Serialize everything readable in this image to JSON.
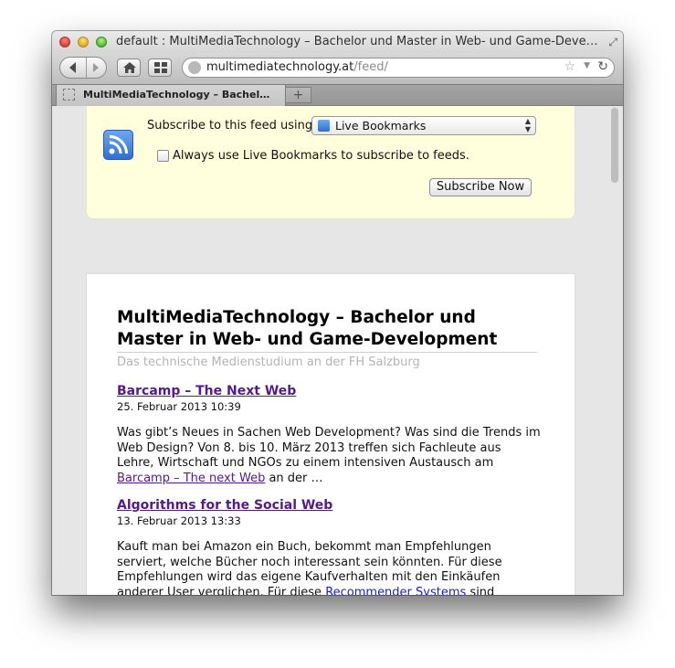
{
  "window": {
    "title": "default : MultiMediaTechnology – Bachelor und Master in Web- und Game-Develo…"
  },
  "toolbar": {
    "url_host": "multimediatechnology.at",
    "url_path": "/feed/"
  },
  "tabs": [
    {
      "label": "MultiMediaTechnology – Bachel…"
    }
  ],
  "subscribe": {
    "label": "Subscribe to this feed using",
    "selected_reader": "Live Bookmarks",
    "always_use_label": "Always use Live Bookmarks to subscribe to feeds.",
    "always_use_checked": false,
    "button_label": "Subscribe Now"
  },
  "feed": {
    "title": "MultiMediaTechnology – Bachelor und Master in Web- und Game-Development",
    "subtitle": "Das technische Medienstudium an der FH Salzburg",
    "entries": [
      {
        "title": "Barcamp – The Next Web",
        "date": "25. Februar 2013 10:39",
        "text_before": "Was gibt’s Neues in Sachen Web Development? Was sind die Trends im Web Design? Von 8. bis 10. März 2013 treffen sich Fachleute aus Lehre, Wirtschaft und NGOs zu einem intensiven Austausch am ",
        "link": "Barcamp – The next Web",
        "text_after": " an der …"
      },
      {
        "title": "Algorithms for the Social Web",
        "date": "13. Februar 2013 13:33",
        "text_before": "Kauft man bei Amazon ein Buch, bekommt man Empfehlungen serviert, welche Bücher noch interessant sein könnten. Für diese Empfehlungen wird das eigene Kaufverhalten mit den Einkäufen anderer User verglichen. Für diese ",
        "link": "Recommender Systems ",
        "text_after": "sind aufwendige Berechnungen auf sehr großen Datenbeständen …"
      }
    ]
  },
  "colors": {
    "subscribe_box_bg": "#ffffdd",
    "visited_link": "#551a8b",
    "unvisited_link": "#1a1ad6",
    "subtitle_gray": "#b5b5b5"
  }
}
